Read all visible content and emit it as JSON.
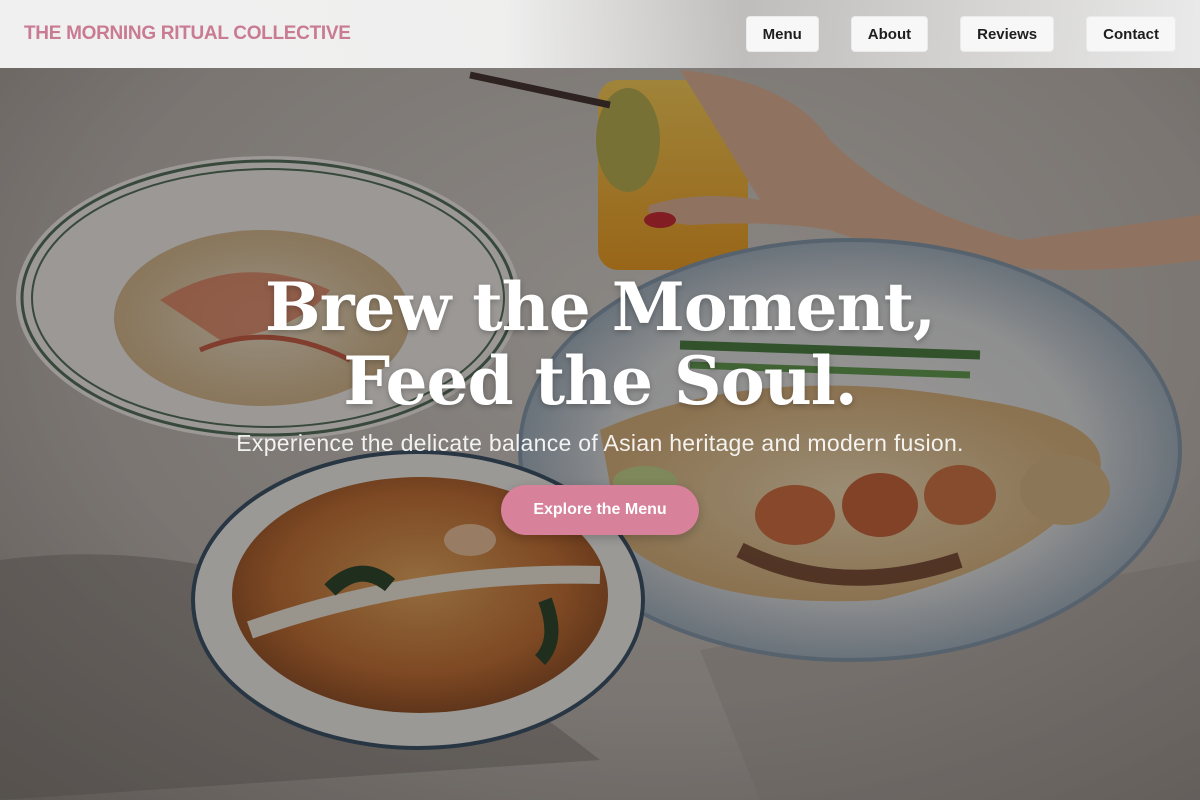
{
  "brand": {
    "name": "THE MORNING RITUAL COLLECTIVE",
    "color": "#c97b94"
  },
  "nav": {
    "items": [
      {
        "label": "Menu"
      },
      {
        "label": "About"
      },
      {
        "label": "Reviews"
      },
      {
        "label": "Contact"
      }
    ]
  },
  "hero": {
    "headline": "Brew the Moment, Feed the Soul.",
    "subheadline": "Experience the delicate balance of Asian heritage and modern fusion.",
    "cta_label": "Explore the Menu",
    "cta_color": "#d7819a",
    "background_image": "food-table-photo"
  }
}
